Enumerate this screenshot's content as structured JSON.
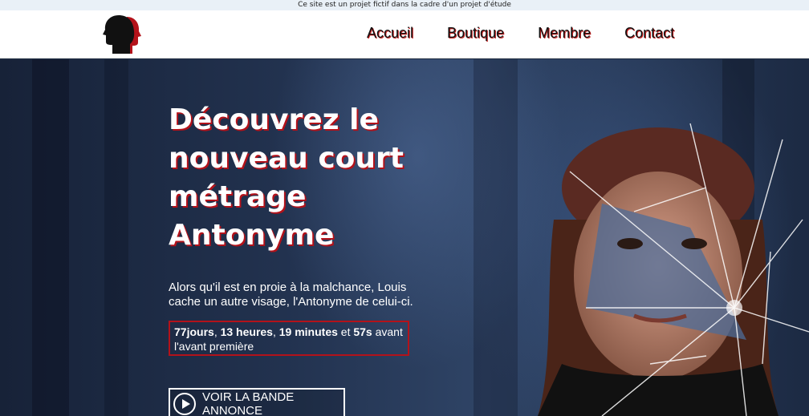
{
  "topbar": {
    "notice": "Ce site est un projet fictif dans la cadre d'un projet d'étude"
  },
  "nav": {
    "logo_icon": "two-heads-logo-icon",
    "links": [
      "Accueil",
      "Boutique",
      "Membre",
      "Contact"
    ]
  },
  "hero": {
    "title": "Découvrez le nouveau court métrage Antonyme",
    "description": "Alors qu'il est en proie à la malchance, Louis cache un autre visage, l'Antonyme de celui-ci.",
    "countdown": {
      "days": "77jours",
      "hours": "13 heures",
      "minutes": "19 minutes",
      "sep_and": "et",
      "seconds": "57s",
      "suffix": "avant l'avant première"
    },
    "trailer_button": {
      "label": "VOIR LA BANDE ANNONCE",
      "icon": "play-circle-icon"
    },
    "image": "shattered-mirror-portrait"
  },
  "colors": {
    "accent_red": "#b3121a",
    "nav_bg": "#ffffff",
    "hero_bg": "#1d2c44"
  }
}
